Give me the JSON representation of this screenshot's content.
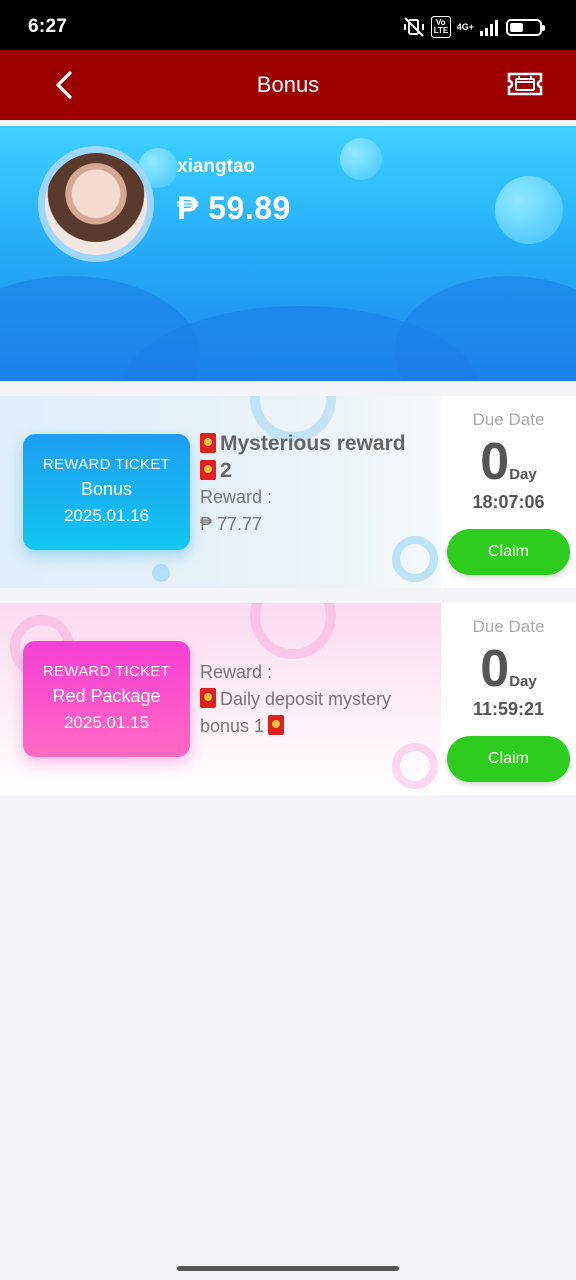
{
  "status_bar": {
    "time": "6:27",
    "network": "4G+",
    "volte": "Vo LTE",
    "battery_level": 0.45
  },
  "header": {
    "title": "Bonus",
    "back_icon": "chevron-left-icon",
    "ticket_icon": "ticket-icon"
  },
  "profile": {
    "username": "xiangtao",
    "balance": "₱ 59.89"
  },
  "rewards": [
    {
      "ticket_label": "REWARD TICKET",
      "ticket_type": "Bonus",
      "ticket_date": "2025.01.16",
      "name_line1": "Mysterious reward",
      "name_line2": "2",
      "reward_label": "Reward :",
      "reward_value": "₱ 77.77",
      "due_label": "Due Date",
      "days": "0",
      "days_unit": "Day",
      "time_left": "18:07:06",
      "claim_label": "Claim"
    },
    {
      "ticket_label": "REWARD TICKET",
      "ticket_type": "Red Package",
      "ticket_date": "2025.01.15",
      "reward_label": "Reward :",
      "desc_line1": "Daily deposit mystery",
      "desc_line2": "bonus 1",
      "due_label": "Due Date",
      "days": "0",
      "days_unit": "Day",
      "time_left": "11:59:21",
      "claim_label": "Claim"
    }
  ],
  "colors": {
    "header_bg": "#9c0000",
    "claim_bg": "#2ecc1e",
    "profile_blue": "#28aef8"
  }
}
